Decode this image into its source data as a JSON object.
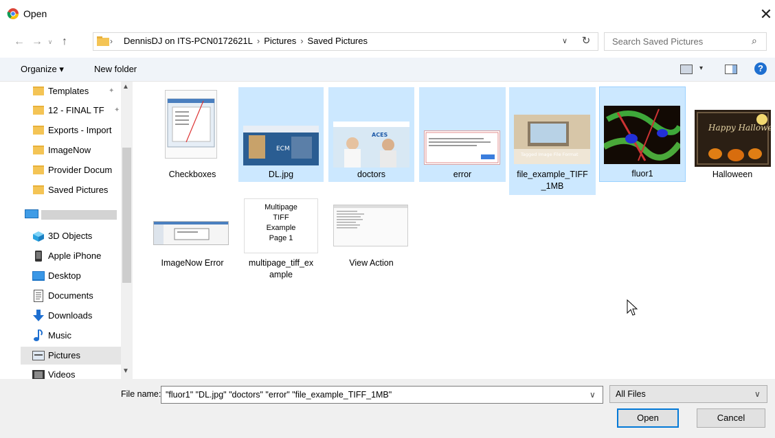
{
  "window": {
    "title": "Open",
    "close_glyph": "✕"
  },
  "nav": {
    "back": "←",
    "forward": "→",
    "recent": "∨",
    "up": "↑"
  },
  "address": {
    "chevron": "›",
    "crumbs": [
      "DennisDJ on ITS-PCN0172621L",
      "Pictures",
      "Saved Pictures"
    ],
    "separator": "›",
    "dropdown": "∨",
    "refresh": "↻"
  },
  "search": {
    "placeholder": "Search Saved Pictures",
    "icon": "⌕"
  },
  "toolbar": {
    "organize": "Organize ▾",
    "new_folder": "New folder",
    "view_dropdown": "▾",
    "help": "?"
  },
  "sidebar": {
    "items": [
      {
        "label": "Templates",
        "icon": "folder-icon",
        "pin": "📌"
      },
      {
        "label": "12 - FINAL TF",
        "icon": "folder-icon",
        "pin": "📌"
      },
      {
        "label": "Exports - Import",
        "icon": "folder-icon"
      },
      {
        "label": "ImageNow",
        "icon": "folder-icon"
      },
      {
        "label": "Provider Docum",
        "icon": "folder-icon"
      },
      {
        "label": "Saved Pictures",
        "icon": "folder-icon"
      }
    ],
    "pc_items": [
      {
        "label": "3D Objects",
        "icon": "3d-objects-icon"
      },
      {
        "label": "Apple iPhone",
        "icon": "phone-icon"
      },
      {
        "label": "Desktop",
        "icon": "desktop-icon"
      },
      {
        "label": "Documents",
        "icon": "documents-icon"
      },
      {
        "label": "Downloads",
        "icon": "downloads-icon"
      },
      {
        "label": "Music",
        "icon": "music-icon"
      },
      {
        "label": "Pictures",
        "icon": "pictures-icon"
      },
      {
        "label": "Videos",
        "icon": "videos-icon"
      }
    ],
    "scroll_up": "▲",
    "scroll_down": "▼"
  },
  "files": [
    {
      "name": "Checkboxes",
      "selected": false
    },
    {
      "name": "DL.jpg",
      "selected": true
    },
    {
      "name": "doctors",
      "selected": true
    },
    {
      "name": "error",
      "selected": true
    },
    {
      "name": "file_example_TIFF_1MB",
      "name_lines": [
        "file_example_TIFF",
        "_1MB"
      ],
      "selected": true
    },
    {
      "name": "fluor1",
      "selected": true
    },
    {
      "name": "Halloween",
      "selected": false
    },
    {
      "name": "ImageNow Error",
      "selected": false
    },
    {
      "name": "multipage_tiff_example",
      "name_lines": [
        "multipage_tiff_ex",
        "ample"
      ],
      "selected": false,
      "thumb_text": [
        "Multipage",
        "TIFF",
        "Example",
        "Page 1"
      ]
    },
    {
      "name": "View Action",
      "selected": false
    }
  ],
  "thumb_texts": {
    "dl": "ECM",
    "doctors": "ACES",
    "tiff": "Tagged Image File Format",
    "halloween": "Happy Halloween"
  },
  "bottom": {
    "file_name_label": "File name:",
    "file_name_value": "\"fluor1\" \"DL.jpg\" \"doctors\" \"error\" \"file_example_TIFF_1MB\"",
    "filter_value": "All Files",
    "dropdown": "∨",
    "open_button": "Open",
    "cancel_button": "Cancel"
  },
  "colors": {
    "selection": "#cce8ff",
    "accent": "#0078d7",
    "folder": "#f4c455"
  }
}
